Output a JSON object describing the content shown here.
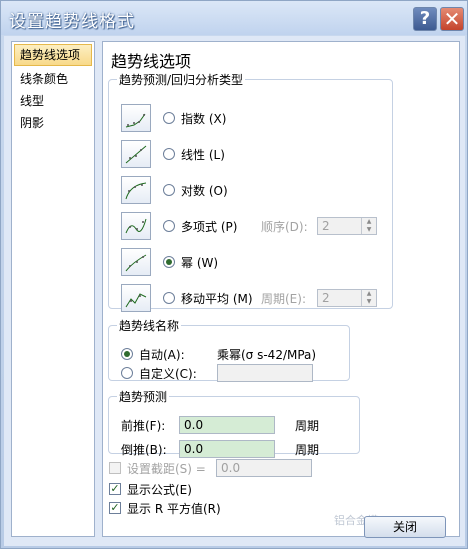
{
  "window": {
    "title": "设置趋势线格式",
    "help_glyph": "?",
    "close_glyph": "✕"
  },
  "sidebar": {
    "items": [
      {
        "label": "趋势线选项",
        "selected": true
      },
      {
        "label": "线条颜色",
        "selected": false
      },
      {
        "label": "线型",
        "selected": false
      },
      {
        "label": "阴影",
        "selected": false
      }
    ]
  },
  "panel": {
    "title": "趋势线选项",
    "type_group": {
      "legend": "趋势预测/回归分析类型",
      "options": [
        {
          "label": "指数",
          "key": "(X)",
          "icon": "exponential-trend-icon",
          "checked": false
        },
        {
          "label": "线性",
          "key": "(L)",
          "icon": "linear-trend-icon",
          "checked": false
        },
        {
          "label": "对数",
          "key": "(O)",
          "icon": "logarithmic-trend-icon",
          "checked": false
        },
        {
          "label": "多项式",
          "key": "(P)",
          "icon": "polynomial-trend-icon",
          "checked": false
        },
        {
          "label": "幂",
          "key": "(W)",
          "icon": "power-trend-icon",
          "checked": true
        },
        {
          "label": "移动平均",
          "key": "(M)",
          "icon": "moving-average-trend-icon",
          "checked": false
        }
      ],
      "order_label": "顺序(D):",
      "order_value": "2",
      "period_label": "周期(E):",
      "period_value": "2"
    },
    "name_group": {
      "legend": "趋势线名称",
      "auto_label": "自动(A):",
      "auto_value": "乘幂(σ s-42/MPa)",
      "custom_label": "自定义(C):",
      "custom_value": ""
    },
    "forecast_group": {
      "legend": "趋势预测",
      "forward_label": "前推(F):",
      "forward_value": "0.0",
      "forward_unit": "周期",
      "backward_label": "倒推(B):",
      "backward_value": "0.0",
      "backward_unit": "周期"
    },
    "intercept": {
      "label": "设置截距(S) =",
      "value": "0.0",
      "checked": false,
      "enabled": false
    },
    "show_equation": {
      "label": "显示公式(E)",
      "checked": true
    },
    "show_r2": {
      "label": "显示 R 平方值(R)",
      "checked": true
    }
  },
  "footer": {
    "close_label": "关闭",
    "watermark": "铝合金模"
  },
  "colors": {
    "title_bar": "#c0d3ee",
    "selected_item": "#f8d98a",
    "input_fill": "#d5ecd5"
  }
}
